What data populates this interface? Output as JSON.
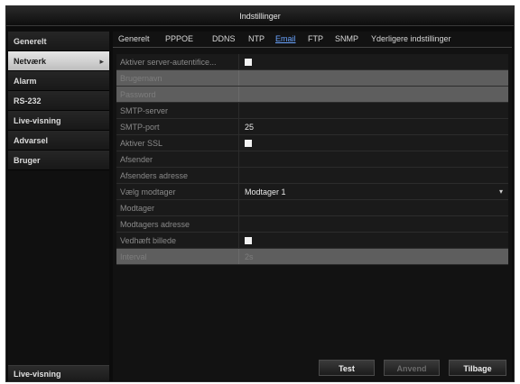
{
  "window": {
    "title": "Indstillinger"
  },
  "sidebar": {
    "items": [
      {
        "label": "Generelt"
      },
      {
        "label": "Netværk"
      },
      {
        "label": "Alarm"
      },
      {
        "label": "RS-232"
      },
      {
        "label": "Live-visning"
      },
      {
        "label": "Advarsel"
      },
      {
        "label": "Bruger"
      }
    ],
    "active_index": 1,
    "bottom_label": "Live-visning"
  },
  "tabs": [
    {
      "label": "Generelt"
    },
    {
      "label": "PPPOE"
    },
    {
      "label": "DDNS"
    },
    {
      "label": "NTP"
    },
    {
      "label": "Email"
    },
    {
      "label": "FTP"
    },
    {
      "label": "SNMP"
    },
    {
      "label": "Yderligere indstillinger"
    }
  ],
  "active_tab": "Email",
  "form": {
    "rows": [
      {
        "label": "Aktiver server-autentifice...",
        "checkbox": true
      },
      {
        "label": "Brugernavn",
        "value": "",
        "disabled": true
      },
      {
        "label": "Password",
        "value": "",
        "disabled": true
      },
      {
        "label": "SMTP-server",
        "value": ""
      },
      {
        "label": "SMTP-port",
        "value": "25"
      },
      {
        "label": "Aktiver SSL",
        "checkbox": true
      },
      {
        "label": "Afsender",
        "value": ""
      },
      {
        "label": "Afsenders adresse",
        "value": ""
      },
      {
        "label": "Vælg modtager",
        "value": "Modtager 1",
        "dropdown": true
      },
      {
        "label": "Modtager",
        "value": ""
      },
      {
        "label": "Modtagers adresse",
        "value": ""
      },
      {
        "label": "Vedhæft billede",
        "checkbox": true
      },
      {
        "label": "Interval",
        "value": "2s",
        "disabled": true
      }
    ]
  },
  "buttons": {
    "test": "Test",
    "apply": "Anvend",
    "back": "Tilbage"
  },
  "colors": {
    "active_tab": "#6aa4ff",
    "disabled_row": "#5e5e5e"
  }
}
